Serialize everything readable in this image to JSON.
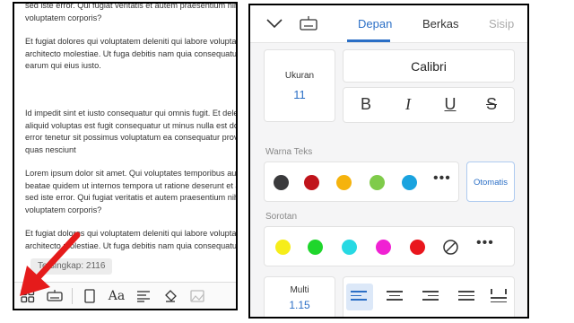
{
  "document": {
    "paragraphs": [
      [
        "sed iste error. Qui fugiat veritatis et autem praesentium nihil",
        "voluptatem corporis?"
      ],
      [
        "Et fugiat dolores qui voluptatem deleniti qui labore voluptas",
        "architecto molestiae. Ut fuga debitis nam quia consequatur",
        "earum qui eius iusto."
      ],
      [
        ""
      ],
      [
        "Id impedit sint et iusto consequatur qui omnis fugit. Et delet",
        "aliquid voluptas est fugit consequatur ut minus nulla est dolor",
        "error tenetur sit possimus voluptatum ea consequatur prov",
        "quas nesciunt"
      ],
      [
        "Lorem ipsum dolor sit amet. Qui voluptates temporibus aut",
        "beatae quidem ut internos tempora ut ratione deserunt et a",
        "sed iste error. Qui fugiat veritatis et autem praesentium nihil",
        "voluptatem corporis?"
      ],
      [
        "Et fugiat dolores qui voluptatem deleniti qui labore voluptas",
        "architecto molestiae. Ut fuga debitis nam quia consequatur"
      ]
    ],
    "word_count": "Tersingkap: 2116"
  },
  "left_toolbar": {
    "icons": [
      "grid-icon",
      "keyboard-icon",
      "page-icon",
      "font-icon",
      "align-icon",
      "paint-icon",
      "image-icon"
    ]
  },
  "tabs": {
    "items": [
      "Depan",
      "Berkas",
      "Sisip"
    ],
    "active": "Depan"
  },
  "font": {
    "size_label": "Ukuran",
    "size_value": "11",
    "name": "Calibri"
  },
  "format_buttons": [
    "B",
    "I",
    "U",
    "S"
  ],
  "text_color": {
    "label": "Warna Teks",
    "colors": [
      "#3a3a3c",
      "#c0141b",
      "#f5b30d",
      "#7fcb4a",
      "#1aa3df"
    ],
    "auto_label": "Otomatis"
  },
  "highlight": {
    "label": "Sorotan",
    "colors": [
      "#f6ed1a",
      "#1fd62c",
      "#27d9e3",
      "#f021d3",
      "#e9161d"
    ]
  },
  "spacing": {
    "label": "Multi",
    "value": "1.15"
  },
  "accent": "#2b6fc6"
}
